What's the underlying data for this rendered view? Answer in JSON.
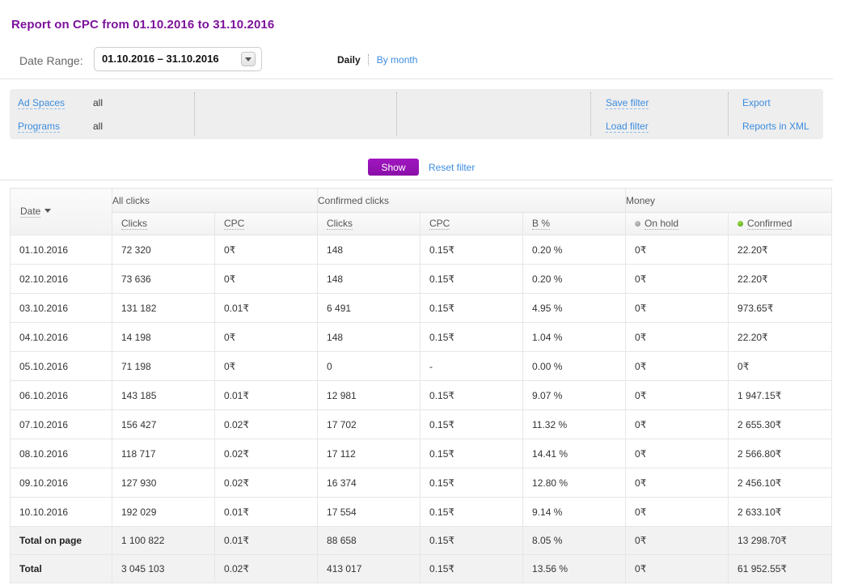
{
  "title": "Report on CPC from 01.10.2016 to 31.10.2016",
  "date_range": {
    "label": "Date Range:",
    "value": "01.10.2016  –  31.10.2016",
    "dropdown_icon": "chevron-down-icon"
  },
  "period_switch": {
    "active": "Daily",
    "link": "By month"
  },
  "filters": {
    "rows": [
      {
        "link": "Ad Spaces",
        "value": "all"
      },
      {
        "link": "Programs",
        "value": "all"
      }
    ],
    "save_filter": "Save filter",
    "load_filter": "Load filter",
    "export": "Export",
    "reports_xml": "Reports in XML"
  },
  "actions": {
    "show": "Show",
    "reset": "Reset filter"
  },
  "table": {
    "group_headers": [
      {
        "label": "",
        "span": 1
      },
      {
        "label": "All clicks",
        "span": 2
      },
      {
        "label": "Confirmed clicks",
        "span": 3
      },
      {
        "label": "Money",
        "span": 2
      }
    ],
    "date_header": "Date",
    "sub_headers": [
      {
        "label": "Clicks",
        "icon": ""
      },
      {
        "label": "CPC",
        "icon": ""
      },
      {
        "label": "Clicks",
        "icon": ""
      },
      {
        "label": "CPC",
        "icon": ""
      },
      {
        "label": "B %",
        "icon": ""
      },
      {
        "label": "On hold",
        "icon": "gray-dot-icon"
      },
      {
        "label": "Confirmed",
        "icon": "green-dot-icon"
      }
    ],
    "rows": [
      {
        "date": "01.10.2016",
        "all_clicks": "72 320",
        "all_cpc": "0₹",
        "conf_clicks": "148",
        "conf_cpc": "0.15₹",
        "b_pct": "0.20 %",
        "on_hold": "0₹",
        "confirmed": "22.20₹"
      },
      {
        "date": "02.10.2016",
        "all_clicks": "73 636",
        "all_cpc": "0₹",
        "conf_clicks": "148",
        "conf_cpc": "0.15₹",
        "b_pct": "0.20 %",
        "on_hold": "0₹",
        "confirmed": "22.20₹"
      },
      {
        "date": "03.10.2016",
        "all_clicks": "131 182",
        "all_cpc": "0.01₹",
        "conf_clicks": "6 491",
        "conf_cpc": "0.15₹",
        "b_pct": "4.95 %",
        "on_hold": "0₹",
        "confirmed": "973.65₹"
      },
      {
        "date": "04.10.2016",
        "all_clicks": "14 198",
        "all_cpc": "0₹",
        "conf_clicks": "148",
        "conf_cpc": "0.15₹",
        "b_pct": "1.04 %",
        "on_hold": "0₹",
        "confirmed": "22.20₹"
      },
      {
        "date": "05.10.2016",
        "all_clicks": "71 198",
        "all_cpc": "0₹",
        "conf_clicks": "0",
        "conf_cpc": "-",
        "b_pct": "0.00 %",
        "on_hold": "0₹",
        "confirmed": "0₹"
      },
      {
        "date": "06.10.2016",
        "all_clicks": "143 185",
        "all_cpc": "0.01₹",
        "conf_clicks": "12 981",
        "conf_cpc": "0.15₹",
        "b_pct": "9.07 %",
        "on_hold": "0₹",
        "confirmed": "1 947.15₹"
      },
      {
        "date": "07.10.2016",
        "all_clicks": "156 427",
        "all_cpc": "0.02₹",
        "conf_clicks": "17 702",
        "conf_cpc": "0.15₹",
        "b_pct": "11.32 %",
        "on_hold": "0₹",
        "confirmed": "2 655.30₹"
      },
      {
        "date": "08.10.2016",
        "all_clicks": "118 717",
        "all_cpc": "0.02₹",
        "conf_clicks": "17 112",
        "conf_cpc": "0.15₹",
        "b_pct": "14.41 %",
        "on_hold": "0₹",
        "confirmed": "2 566.80₹"
      },
      {
        "date": "09.10.2016",
        "all_clicks": "127 930",
        "all_cpc": "0.02₹",
        "conf_clicks": "16 374",
        "conf_cpc": "0.15₹",
        "b_pct": "12.80 %",
        "on_hold": "0₹",
        "confirmed": "2 456.10₹"
      },
      {
        "date": "10.10.2016",
        "all_clicks": "192 029",
        "all_cpc": "0.01₹",
        "conf_clicks": "17 554",
        "conf_cpc": "0.15₹",
        "b_pct": "9.14 %",
        "on_hold": "0₹",
        "confirmed": "2 633.10₹"
      }
    ],
    "totals": [
      {
        "date": "Total on page",
        "all_clicks": "1 100 822",
        "all_cpc": "0.01₹",
        "conf_clicks": "88 658",
        "conf_cpc": "0.15₹",
        "b_pct": "8.05 %",
        "on_hold": "0₹",
        "confirmed": "13 298.70₹"
      },
      {
        "date": "Total",
        "all_clicks": "3 045 103",
        "all_cpc": "0.02₹",
        "conf_clicks": "413 017",
        "conf_cpc": "0.15₹",
        "b_pct": "13.56 %",
        "on_hold": "0₹",
        "confirmed": "61 952.55₹"
      }
    ]
  },
  "colors": {
    "brand_purple": "#7d129c",
    "link_blue": "#3b8cde",
    "panel_gray": "#eeeeee",
    "confirmed_green": "#4e9e12"
  }
}
